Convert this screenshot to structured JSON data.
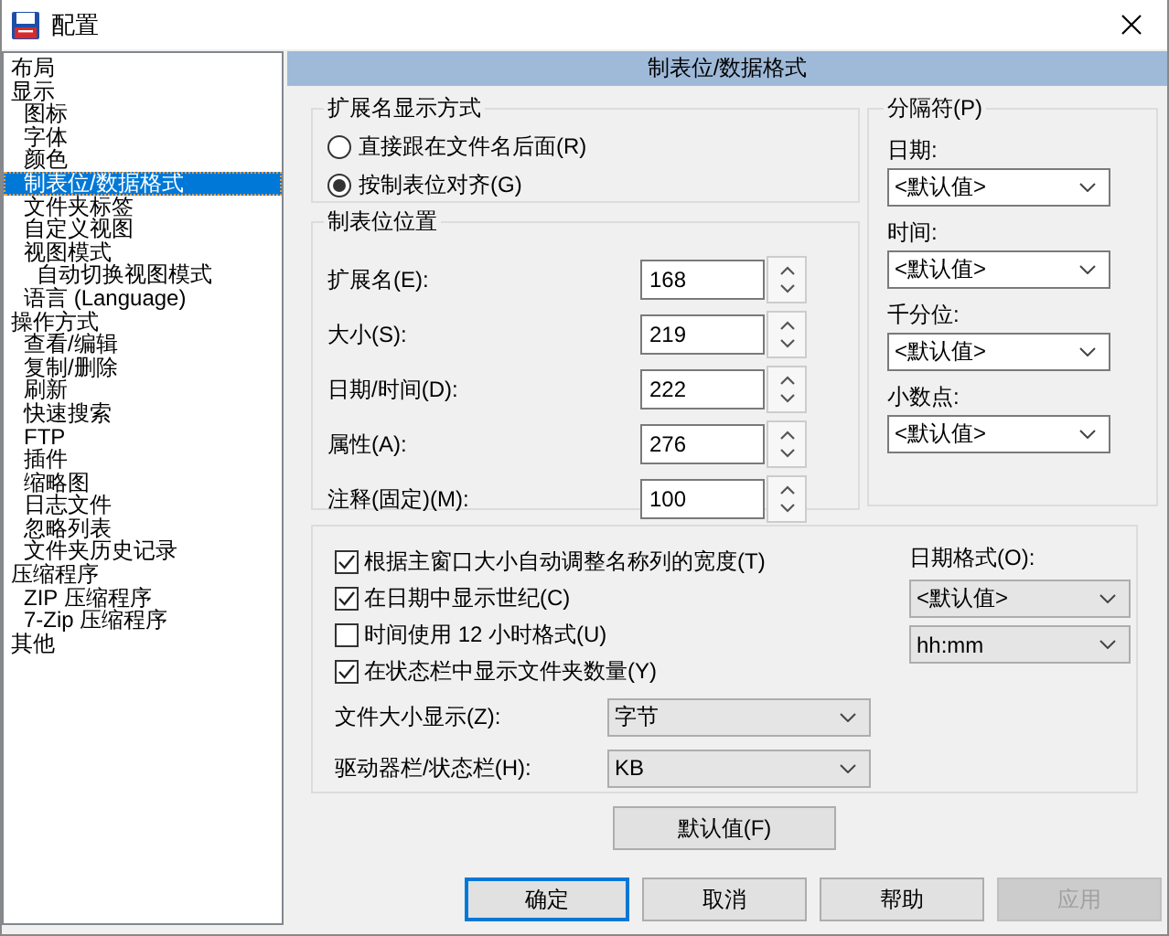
{
  "window": {
    "title": "配置"
  },
  "sidebar": {
    "items": [
      {
        "label": "布局",
        "selected": false
      },
      {
        "label": "显示",
        "selected": false,
        "children": [
          {
            "label": "图标",
            "selected": false
          },
          {
            "label": "字体",
            "selected": false
          },
          {
            "label": "颜色",
            "selected": false
          },
          {
            "label": "制表位/数据格式",
            "selected": true
          },
          {
            "label": "文件夹标签",
            "selected": false
          },
          {
            "label": "自定义视图",
            "selected": false
          },
          {
            "label": "视图模式",
            "selected": false,
            "children": [
              {
                "label": "自动切换视图模式",
                "selected": false
              }
            ]
          },
          {
            "label": "语言 (Language)",
            "selected": false
          }
        ]
      },
      {
        "label": "操作方式",
        "selected": false,
        "children": [
          {
            "label": "查看/编辑",
            "selected": false
          },
          {
            "label": "复制/删除",
            "selected": false
          },
          {
            "label": "刷新",
            "selected": false
          },
          {
            "label": "快速搜索",
            "selected": false
          },
          {
            "label": "FTP",
            "selected": false
          },
          {
            "label": "插件",
            "selected": false
          },
          {
            "label": "缩略图",
            "selected": false
          },
          {
            "label": "日志文件",
            "selected": false
          },
          {
            "label": "忽略列表",
            "selected": false
          },
          {
            "label": "文件夹历史记录",
            "selected": false
          }
        ]
      },
      {
        "label": "压缩程序",
        "selected": false,
        "children": [
          {
            "label": "ZIP 压缩程序",
            "selected": false
          },
          {
            "label": "7-Zip 压缩程序",
            "selected": false
          }
        ]
      },
      {
        "label": "其他",
        "selected": false
      }
    ]
  },
  "panel": {
    "title": "制表位/数据格式"
  },
  "extension_display": {
    "title": "扩展名显示方式",
    "options": [
      {
        "label": "直接跟在文件名后面(R)",
        "selected": false
      },
      {
        "label": "按制表位对齐(G)",
        "selected": true
      }
    ]
  },
  "tab_positions": {
    "title": "制表位位置",
    "fields": [
      {
        "label": "扩展名(E):",
        "value": "168"
      },
      {
        "label": "大小(S):",
        "value": "219"
      },
      {
        "label": "日期/时间(D):",
        "value": "222"
      },
      {
        "label": "属性(A):",
        "value": "276"
      },
      {
        "label": "注释(固定)(M):",
        "value": "100"
      }
    ]
  },
  "separators": {
    "title": "分隔符(P)",
    "fields": [
      {
        "label": "日期:",
        "value": "<默认值>"
      },
      {
        "label": "时间:",
        "value": "<默认值>"
      },
      {
        "label": "千分位:",
        "value": "<默认值>"
      },
      {
        "label": "小数点:",
        "value": "<默认值>"
      }
    ]
  },
  "options": {
    "checkboxes": [
      {
        "label": "根据主窗口大小自动调整名称列的宽度(T)",
        "checked": true
      },
      {
        "label": "在日期中显示世纪(C)",
        "checked": true
      },
      {
        "label": "时间使用 12 小时格式(U)",
        "checked": false
      },
      {
        "label": "在状态栏中显示文件夹数量(Y)",
        "checked": true
      }
    ],
    "fields": [
      {
        "label": "文件大小显示(Z):",
        "value": "字节"
      },
      {
        "label": "驱动器栏/状态栏(H):",
        "value": "KB"
      }
    ],
    "date_format": {
      "label": "日期格式(O):",
      "values": [
        "<默认值>",
        "hh:mm"
      ]
    }
  },
  "defaults_button": "默认值(F)",
  "buttons": [
    {
      "label": "确定",
      "default": true,
      "disabled": false
    },
    {
      "label": "取消",
      "default": false,
      "disabled": false
    },
    {
      "label": "帮助",
      "default": false,
      "disabled": false
    },
    {
      "label": "应用",
      "default": false,
      "disabled": true
    }
  ]
}
